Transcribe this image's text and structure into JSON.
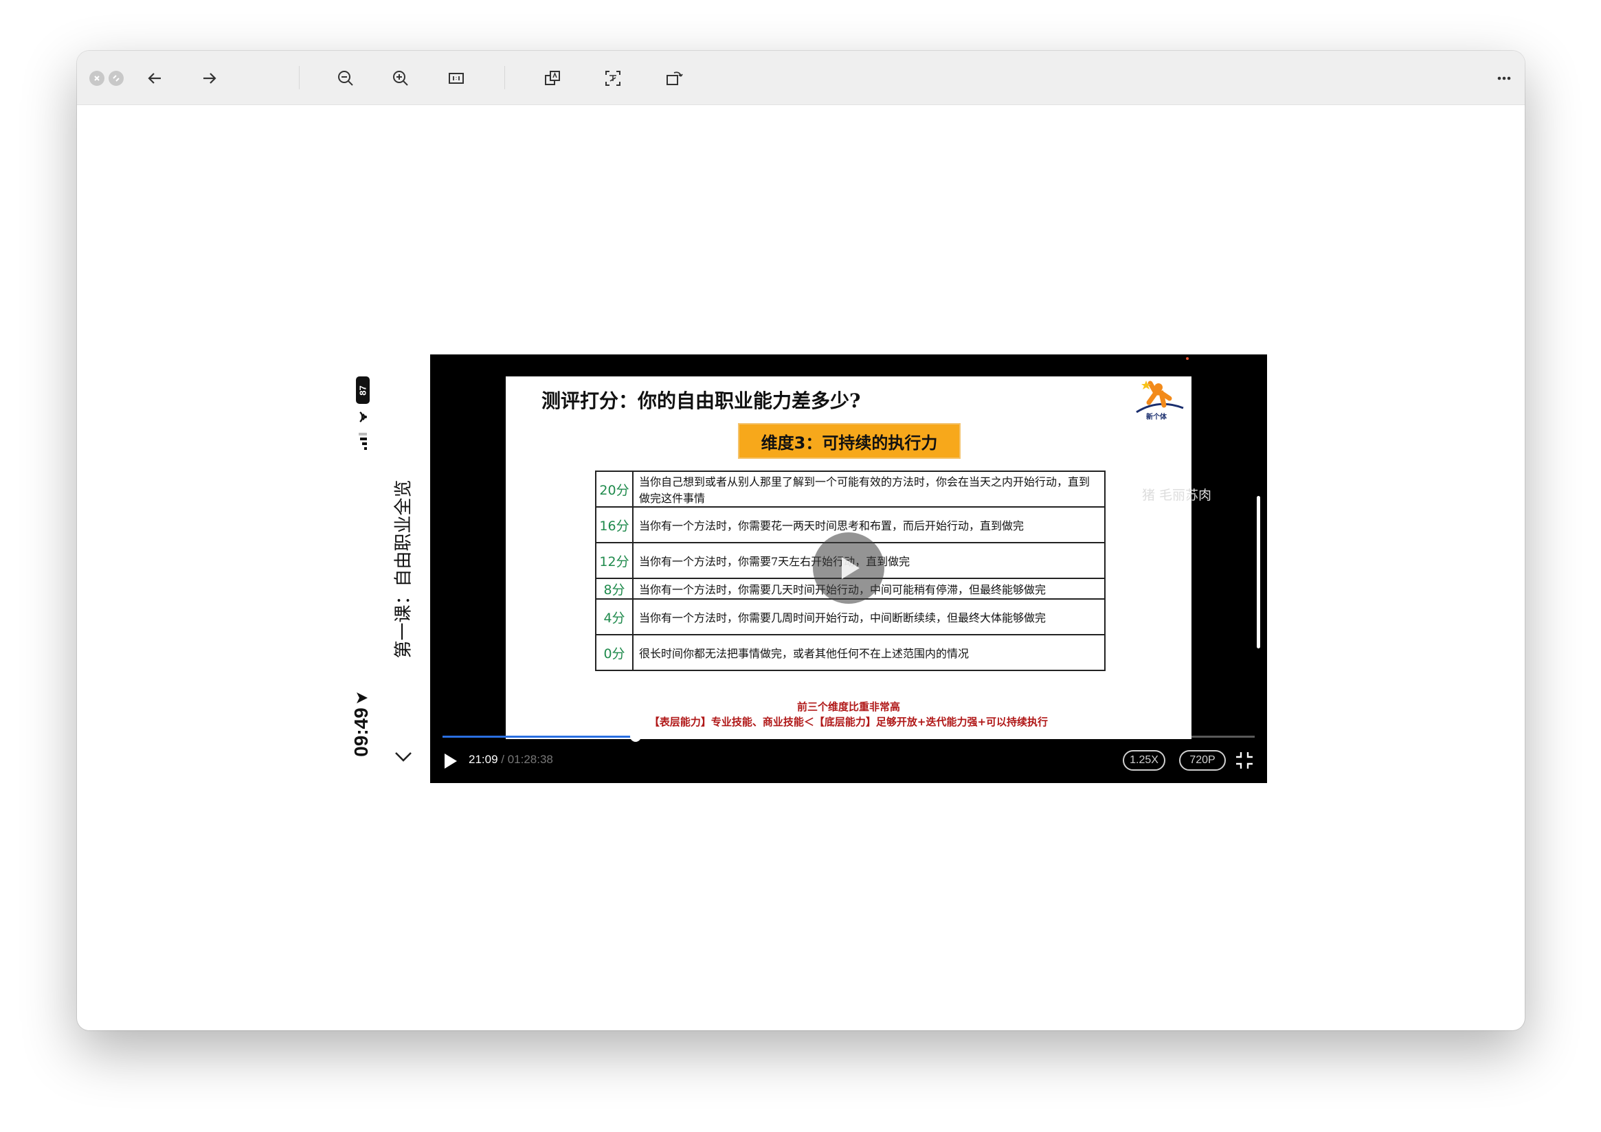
{
  "toolbar": {
    "icons": [
      "close-icon",
      "minimize-icon",
      "back-arrow-icon",
      "forward-arrow-icon",
      "zoom-out-icon",
      "zoom-in-icon",
      "actual-size-icon",
      "translate-icon",
      "ocr-scan-icon",
      "rotate-icon",
      "more-icon"
    ]
  },
  "phone": {
    "time": "09:49",
    "battery": "87",
    "course_title": "第一课：自由职业全览"
  },
  "slide": {
    "title": "测评打分：你的自由职业能力差多少?",
    "logo_text": "新个体",
    "dimension": "维度3：可持续的执行力",
    "rows": [
      {
        "score": "20分",
        "text": "当你自己想到或者从别人那里了解到一个可能有效的方法时，你会在当天之内开始行动，直到做完这件事情"
      },
      {
        "score": "16分",
        "text": "当你有一个方法时，你需要花一两天时间思考和布置，而后开始行动，直到做完"
      },
      {
        "score": "12分",
        "text": "当你有一个方法时，你需要7天左右开始行动，直到做完"
      },
      {
        "score": "8分",
        "text": "当你有一个方法时，你需要几天时间开始行动，中间可能稍有停滞，但最终能够做完"
      },
      {
        "score": "4分",
        "text": "当你有一个方法时，你需要几周时间开始行动，中间断断续续，但最终大体能够做完"
      },
      {
        "score": "0分",
        "text": "很长时间你都无法把事情做完，或者其他任何不在上述范围内的情况"
      }
    ],
    "footnote1": "前三个维度比重非常高",
    "footnote2": "【表层能力】专业技能、商业技能＜【底层能力】足够开放+迭代能力强+可以持续执行"
  },
  "player": {
    "danmaku": "猪  毛丽苏肉",
    "current_time": "21:09",
    "total_time": " / 01:28:38",
    "progress_fraction": 0.238,
    "speed": "1.25X",
    "quality": "720P",
    "accent_color": "#2a6fe0"
  }
}
